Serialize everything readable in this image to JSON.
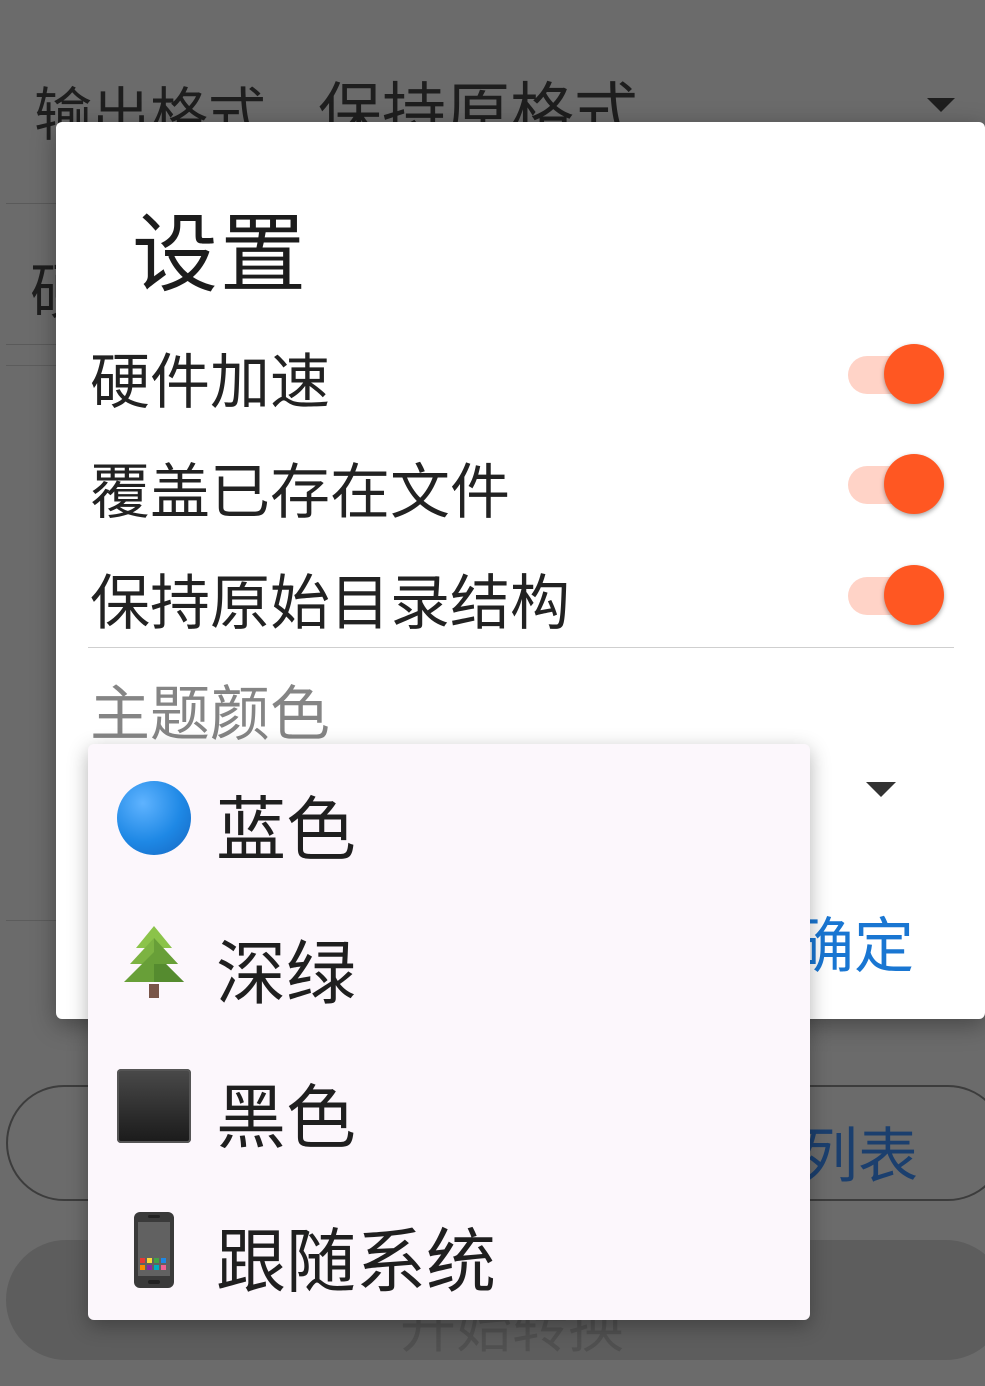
{
  "background": {
    "format_label": "输出格式",
    "format_value": "保持原格式",
    "hw_label_fragment": "硬",
    "list_button_fragment": "列表",
    "start_button_fragment": "开始转换"
  },
  "dialog": {
    "title": "设置",
    "settings": [
      {
        "label": "硬件加速",
        "enabled": true
      },
      {
        "label": "覆盖已存在文件",
        "enabled": true
      },
      {
        "label": "保持原始目录结构",
        "enabled": true
      }
    ],
    "theme_section_label": "主题颜色",
    "confirm_label": "确定"
  },
  "theme_menu": {
    "items": [
      {
        "label": "蓝色",
        "icon": "blue-circle-icon"
      },
      {
        "label": "深绿",
        "icon": "evergreen-tree-icon"
      },
      {
        "label": "黑色",
        "icon": "black-square-icon"
      },
      {
        "label": "跟随系统",
        "icon": "mobile-phone-icon"
      }
    ]
  },
  "colors": {
    "accent": "#ff5722",
    "accent_track": "#ffd3c7",
    "link": "#1976d2",
    "menu_bg": "#fcf7fc",
    "scrim": "#6b6b6b"
  }
}
